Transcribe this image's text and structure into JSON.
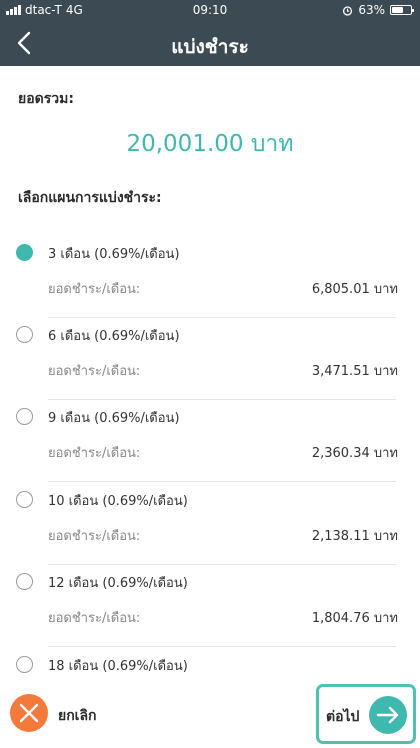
{
  "status_bar": {
    "carrier": "dtac-T",
    "network": "4G",
    "time": "09:10",
    "battery": "63%",
    "battery_level": 0.63
  },
  "header": {
    "title": "แบ่งชำระ"
  },
  "total": {
    "label": "ยอดรวม:",
    "amount": "20,001.00 บาท"
  },
  "plan_section_label": "เลือกแผนการแบ่งชำระ:",
  "plans": [
    {
      "name": "3 เดือน (0.69%/เดือน)",
      "pay_label": "ยอดชำระ/เดือน:",
      "pay_amount": "6,805.01 บาท",
      "selected": true
    },
    {
      "name": "6 เดือน (0.69%/เดือน)",
      "pay_label": "ยอดชำระ/เดือน:",
      "pay_amount": "3,471.51 บาท",
      "selected": false
    },
    {
      "name": "9 เดือน (0.69%/เดือน)",
      "pay_label": "ยอดชำระ/เดือน:",
      "pay_amount": "2,360.34 บาท",
      "selected": false
    },
    {
      "name": "10 เดือน (0.69%/เดือน)",
      "pay_label": "ยอดชำระ/เดือน:",
      "pay_amount": "2,138.11 บาท",
      "selected": false
    },
    {
      "name": "12 เดือน (0.69%/เดือน)",
      "pay_label": "ยอดชำระ/เดือน:",
      "pay_amount": "1,804.76 บาท",
      "selected": false
    },
    {
      "name": "18 เดือน (0.69%/เดือน)",
      "selected": false
    }
  ],
  "footer": {
    "cancel_label": "ยกเลิก",
    "next_label": "ต่อไป"
  },
  "colors": {
    "header_bg": "#3c4b53",
    "accent": "#3fb9ae",
    "cancel": "#f47a3b"
  }
}
